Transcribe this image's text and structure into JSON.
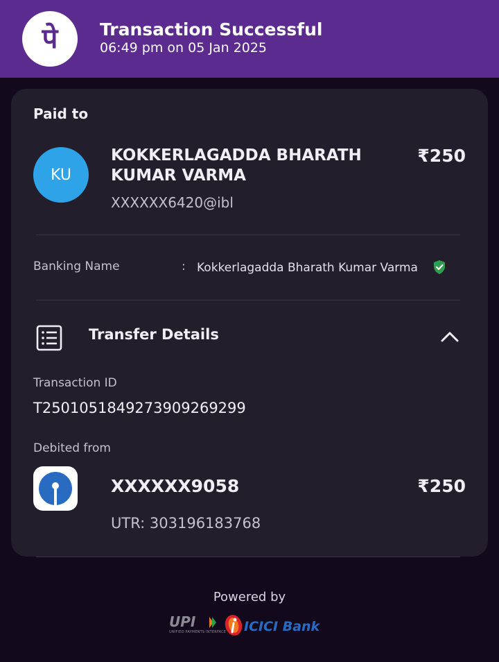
{
  "header": {
    "title": "Transaction Successful",
    "datetime": "06:49 pm on 05 Jan 2025",
    "logo_glyph": "पे",
    "brand_color": "#5b2b8f"
  },
  "payee": {
    "section_label": "Paid to",
    "avatar_initials": "KU",
    "name": "KOKKERLAGADDA BHARATH KUMAR VARMA",
    "upi_id": "XXXXXX6420@ibl",
    "amount": "₹250"
  },
  "banking_name": {
    "label": "Banking Name",
    "separator": ":",
    "value": "Kokkerlagadda Bharath Kumar Varma",
    "verified_icon": "verified-shield-icon"
  },
  "transfer": {
    "title": "Transfer Details",
    "transaction_id_label": "Transaction ID",
    "transaction_id": "T2501051849273909269299",
    "debited_label": "Debited from",
    "account": "XXXXXX9058",
    "amount": "₹250",
    "utr": "UTR: 303196183768"
  },
  "footer": {
    "powered_by": "Powered by",
    "upi_logo": "UPI",
    "upi_tagline": "UNIFIED PAYMENTS INTERFACE",
    "bank_logo": "ICICI Bank"
  }
}
